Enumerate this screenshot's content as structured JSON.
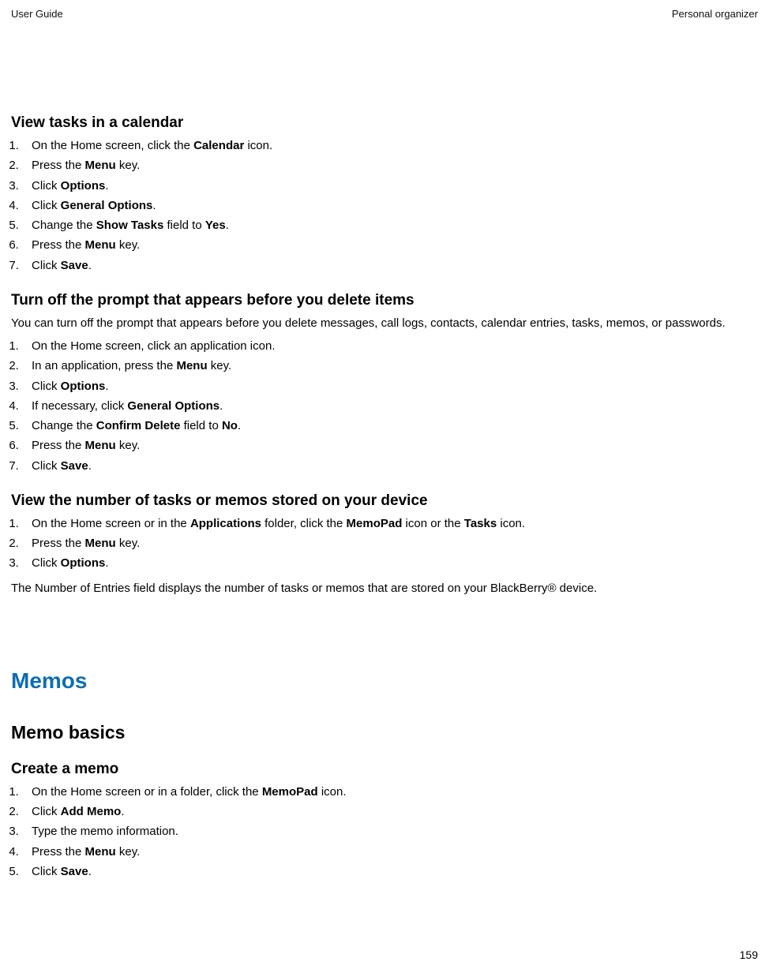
{
  "header": {
    "left": "User Guide",
    "right": "Personal organizer"
  },
  "pageNumber": "159",
  "section1": {
    "title": "View tasks in a calendar",
    "steps": [
      {
        "pre": "On the Home screen, click the ",
        "bold": "Calendar",
        "post": " icon."
      },
      {
        "pre": "Press the ",
        "bold": "Menu",
        "post": " key."
      },
      {
        "pre": "Click ",
        "bold": "Options",
        "post": "."
      },
      {
        "pre": "Click ",
        "bold": "General Options",
        "post": "."
      },
      {
        "pre": "Change the ",
        "bold": "Show Tasks",
        "post": " field to ",
        "bold2": "Yes",
        "post2": "."
      },
      {
        "pre": "Press the ",
        "bold": "Menu",
        "post": " key."
      },
      {
        "pre": "Click ",
        "bold": "Save",
        "post": "."
      }
    ]
  },
  "section2": {
    "title": "Turn off the prompt that appears before you delete items",
    "intro": "You can turn off the prompt that appears before you delete messages, call logs, contacts, calendar entries, tasks, memos, or passwords.",
    "steps": [
      {
        "pre": "On the Home screen, click an application icon."
      },
      {
        "pre": "In an application, press the ",
        "bold": "Menu",
        "post": " key."
      },
      {
        "pre": "Click ",
        "bold": "Options",
        "post": "."
      },
      {
        "pre": "If necessary, click ",
        "bold": "General Options",
        "post": "."
      },
      {
        "pre": "Change the ",
        "bold": "Confirm Delete",
        "post": " field to ",
        "bold2": "No",
        "post2": "."
      },
      {
        "pre": "Press the ",
        "bold": "Menu",
        "post": " key."
      },
      {
        "pre": "Click ",
        "bold": "Save",
        "post": "."
      }
    ]
  },
  "section3": {
    "title": "View the number of tasks or memos stored on your device",
    "steps": [
      {
        "pre": "On the Home screen or in the ",
        "bold": "Applications",
        "post": " folder, click the ",
        "bold2": "MemoPad",
        "post2": " icon or the ",
        "bold3": "Tasks",
        "post3": " icon."
      },
      {
        "pre": "Press the ",
        "bold": "Menu",
        "post": " key."
      },
      {
        "pre": "Click ",
        "bold": "Options",
        "post": "."
      }
    ],
    "outro": "The Number of Entries field displays the number of tasks or memos that are stored on your BlackBerry® device."
  },
  "chapter": {
    "title": "Memos",
    "subtitle": "Memo basics"
  },
  "section4": {
    "title": "Create a memo",
    "steps": [
      {
        "pre": "On the Home screen or in a folder, click the ",
        "bold": "MemoPad",
        "post": " icon."
      },
      {
        "pre": "Click ",
        "bold": "Add Memo",
        "post": "."
      },
      {
        "pre": "Type the memo information."
      },
      {
        "pre": "Press the ",
        "bold": "Menu",
        "post": " key."
      },
      {
        "pre": "Click ",
        "bold": "Save",
        "post": "."
      }
    ]
  }
}
